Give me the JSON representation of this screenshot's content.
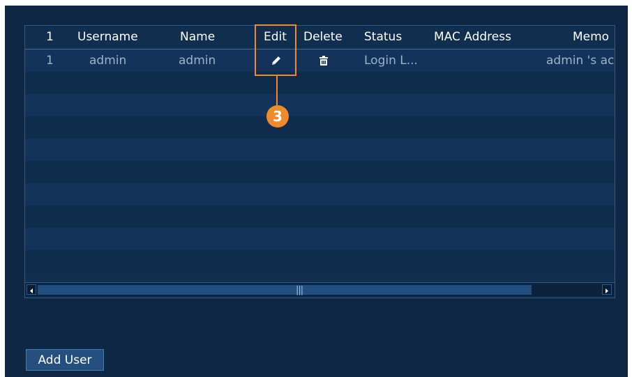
{
  "table": {
    "columns": [
      "1",
      "Username",
      "Name",
      "Edit",
      "Delete",
      "Status",
      "MAC Address",
      "Memo"
    ],
    "rows": [
      {
        "index": "1",
        "username": "admin",
        "name": "admin",
        "status": "Login L...",
        "mac": "",
        "memo": "admin 's account"
      }
    ],
    "edit_icon": "pencil-icon",
    "delete_icon": "trash-icon"
  },
  "annotation": {
    "callout_number": "3"
  },
  "footer": {
    "add_user_label": "Add User"
  },
  "colors": {
    "accent": "#f08a2c",
    "panel": "#0e2745",
    "button": "#244f7f"
  }
}
